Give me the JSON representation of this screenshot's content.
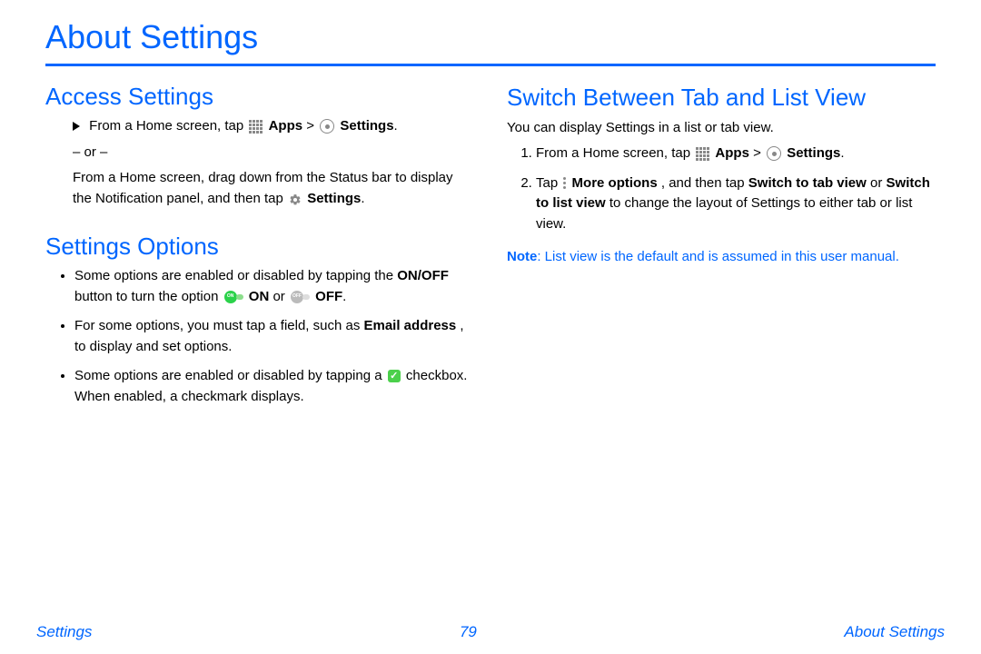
{
  "title": "About Settings",
  "left": {
    "access": {
      "heading": "Access Settings",
      "line1_pre": "From a Home screen, tap ",
      "apps_bold": "Apps",
      "gt": " > ",
      "settings_bold": "Settings",
      "period": ".",
      "or_text": "– or –",
      "line2_pre": "From a Home screen, drag down from the Status bar to display the Notification panel, and then tap ",
      "line2_settings": "Settings",
      "line2_post": "."
    },
    "options": {
      "heading": "Settings Options",
      "b1_pre": "Some options are enabled or disabled by tapping the ",
      "b1_onoff": "ON/OFF",
      "b1_mid": " button to turn the option ",
      "b1_on": "ON",
      "b1_or": " or ",
      "b1_off": "OFF",
      "b1_post": ".",
      "b2_pre": "For some options, you must tap a field, such as ",
      "b2_email": "Email address",
      "b2_post": ", to display and set options.",
      "b3_pre": "Some options are enabled or disabled by tapping a ",
      "b3_post": " checkbox. When enabled, a checkmark displays."
    }
  },
  "right": {
    "switch": {
      "heading": "Switch Between Tab and List View",
      "intro": "You can display Settings in a list or tab view.",
      "s1_pre": "From a Home screen, tap ",
      "apps_bold": "Apps",
      "gt": " > ",
      "settings_bold": "Settings",
      "period": ".",
      "s2_tap": "Tap ",
      "s2_more": "More options",
      "s2_mid1": ", and then tap ",
      "s2_switchtab": "Switch to tab view",
      "s2_or": " or ",
      "s2_switchlist": "Switch to list view",
      "s2_post": " to change the layout of Settings to either tab or list view.",
      "note_label": "Note",
      "note_text": ": List view is the default and is assumed in this user manual."
    }
  },
  "footer": {
    "left": "Settings",
    "center": "79",
    "right": "About Settings"
  },
  "icons": {
    "toggle_on_label": "ON",
    "toggle_off_label": "OFF"
  }
}
